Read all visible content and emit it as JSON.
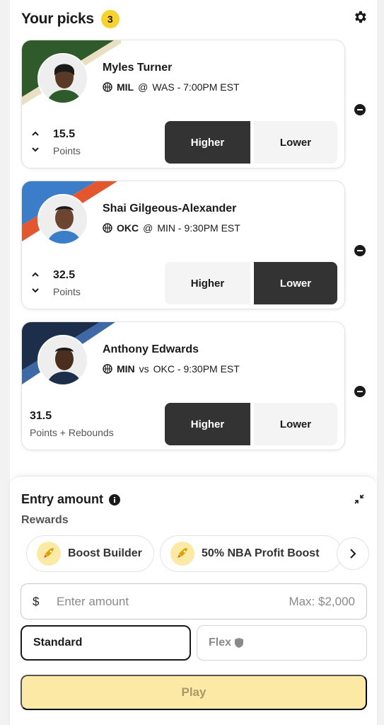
{
  "header": {
    "title": "Your picks",
    "count": "3"
  },
  "picks": [
    {
      "name": "Myles Turner",
      "team": "MIL",
      "sep": "@",
      "opponent_time": "WAS - 7:00PM EST",
      "stat_value": "15.5",
      "stat_label": "Points",
      "selection": "Higher",
      "stripe_colors": [
        "#2f5a2b",
        "#e9dfc2"
      ],
      "jersey_color": "#2f5a2b"
    },
    {
      "name": "Shai Gilgeous-Alexander",
      "team": "OKC",
      "sep": "@",
      "opponent_time": "MIN - 9:30PM EST",
      "stat_value": "32.5",
      "stat_label": "Points",
      "selection": "Lower",
      "stripe_colors": [
        "#3b7dc9",
        "#e4572e"
      ],
      "jersey_color": "#3b7dc9"
    },
    {
      "name": "Anthony Edwards",
      "team": "MIN",
      "sep": "vs",
      "opponent_time": "OKC - 9:30PM EST",
      "stat_value": "31.5",
      "stat_label": "Points + Rebounds",
      "selection": "Higher",
      "stripe_colors": [
        "#1c2e4a",
        "#3d6aa6"
      ],
      "jersey_color": "#1c2e4a"
    }
  ],
  "choices": {
    "higher": "Higher",
    "lower": "Lower"
  },
  "entry": {
    "title": "Entry amount",
    "rewards_label": "Rewards",
    "rewards": [
      "Boost Builder",
      "50% NBA Profit Boost"
    ],
    "currency": "$",
    "placeholder": "Enter amount",
    "max": "Max: $2,000",
    "mode_standard": "Standard",
    "mode_flex": "Flex",
    "play": "Play"
  },
  "icons": {
    "gear": "gear-icon",
    "ball": "basketball-icon",
    "remove": "minus-circle-icon",
    "info": "info-icon",
    "collapse": "collapse-icon",
    "rocket": "rocket-icon",
    "next": "chevron-right-icon",
    "shield": "shield-icon"
  },
  "colors": {
    "accent": "#f7d22e",
    "active": "#333333",
    "play_disabled": "#fbe9a5"
  }
}
